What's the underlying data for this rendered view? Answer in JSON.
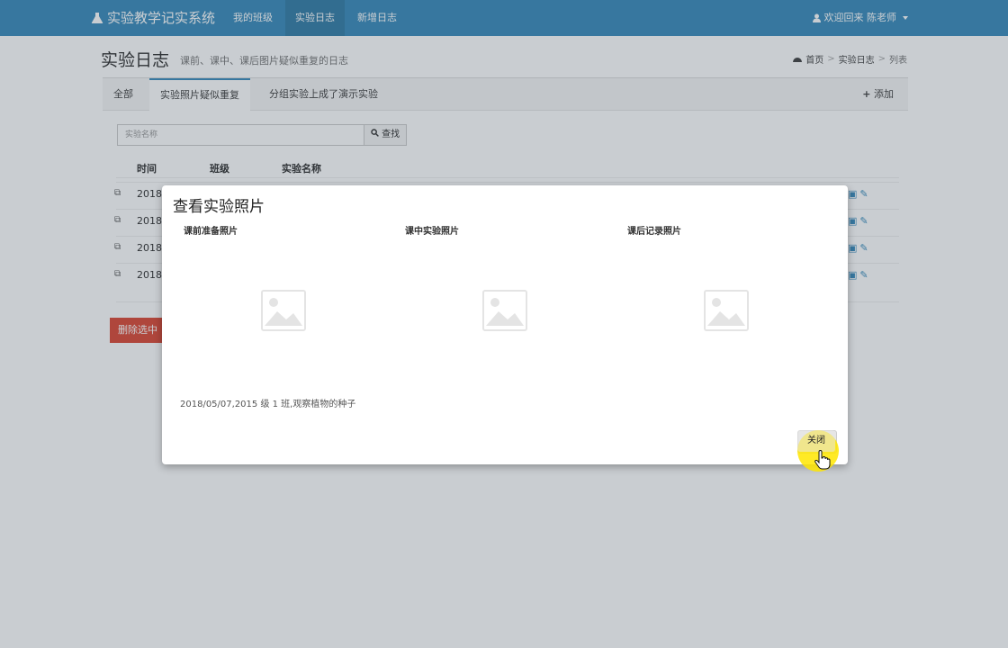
{
  "navbar": {
    "brand": "实验教学记实系统",
    "links": [
      "我的班级",
      "实验日志",
      "新增日志"
    ],
    "active_index": 1,
    "user": "欢迎回来 陈老师"
  },
  "header": {
    "title": "实验日志",
    "subtitle": "课前、课中、课后图片疑似重复的日志",
    "breadcrumb": [
      "首页",
      "实验日志",
      "列表"
    ]
  },
  "tabs": {
    "items": [
      "全部",
      "实验照片疑似重复",
      "分组实验上成了演示实验"
    ],
    "active_index": 1,
    "add_label": "添加"
  },
  "search": {
    "placeholder": "实验名称",
    "button_label": "查找"
  },
  "table": {
    "columns": [
      "时间",
      "班级",
      "实验名称"
    ],
    "rows": [
      {
        "date": "2018/"
      },
      {
        "date": "2018/"
      },
      {
        "date": "2018/"
      },
      {
        "date": "2018/"
      }
    ]
  },
  "delete_button": "删除选中",
  "modal": {
    "title": "查看实验照片",
    "photo_labels": [
      "课前准备照片",
      "课中实验照片",
      "课后记录照片"
    ],
    "caption": "2018/05/07,2015 级 1 班,观察植物的种子",
    "close_label": "关闭"
  },
  "colors": {
    "navbar": "#3c8dbc",
    "danger": "#dd4b39",
    "cursor_highlight": "#ffe600"
  }
}
